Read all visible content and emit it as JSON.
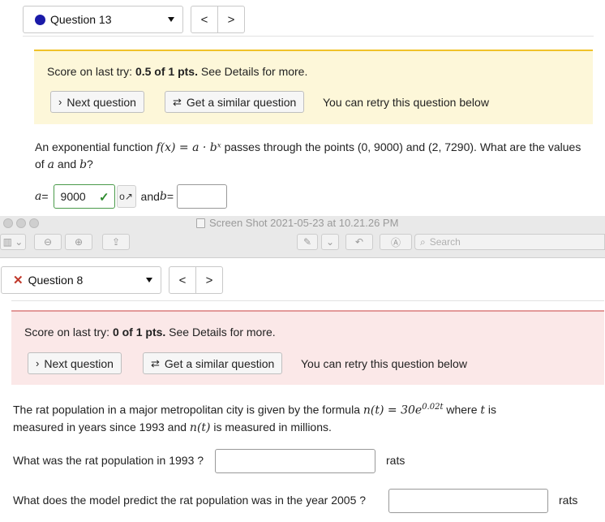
{
  "top": {
    "question_label": "Question 13",
    "nav_prev": "<",
    "nav_next": ">",
    "score_prefix": "Score on last try: ",
    "score_value": "0.5 of 1 pts.",
    "score_suffix": " See Details for more.",
    "next_question": "Next question",
    "similar_question": "Get a similar question",
    "retry_text": "You can retry this question below",
    "prompt_pre": "An exponential function ",
    "prompt_math": "f(x) = a · bˣ",
    "prompt_post": " passes through the points (0, 9000) and (2, 7290). What are the values of ",
    "prompt_a": "a",
    "prompt_and": " and ",
    "prompt_b": "b",
    "prompt_q": "?",
    "a_label_var": "a",
    "a_label_eq": " =",
    "a_value": "9000",
    "key_glyph": "o↗",
    "and_label": "and ",
    "b_label_var": "b",
    "b_label_eq": " ="
  },
  "chrome": {
    "title": "Screen Shot 2021-05-23 at 10.21.26 PM",
    "search_placeholder": "Search",
    "sidebar_glyph": "▥ ⌄",
    "zoom_out_glyph": "⊖",
    "zoom_in_glyph": "⊕",
    "share_glyph": "⇪",
    "markup_glyph": "✎",
    "dropdown_glyph": "⌄",
    "rotate_glyph": "↶",
    "annotate_glyph": "Ⓐ",
    "search_glyph": "⌕"
  },
  "bottom": {
    "question_label": "Question 8",
    "x_glyph": "✕",
    "nav_prev": "<",
    "nav_next": ">",
    "score_prefix": "Score on last try: ",
    "score_value": "0 of 1 pts.",
    "score_suffix": " See Details for more.",
    "next_question": "Next question",
    "similar_question": "Get a similar question",
    "retry_text": "You can retry this question below",
    "prompt_line1_pre": "The rat population in a major metropolitan city is given by the formula ",
    "prompt_math": "n(t) = 30e",
    "prompt_exp": "0.02t",
    "prompt_line1_post": " where ",
    "prompt_t": "t",
    "prompt_is": " is",
    "prompt_line2_pre": "measured in years since 1993 and ",
    "prompt_nt": "n(t)",
    "prompt_line2_post": " is measured in millions.",
    "q1": "What was the rat population in 1993 ?",
    "q1_unit": "rats",
    "q2": "What does the model predict the rat population was in the year 2005 ?",
    "q2_unit": "rats"
  },
  "icons": {
    "next_chevron": "›",
    "similar": "⇄",
    "check": "✓"
  },
  "colors": {
    "accent_yellow": "#f0c229",
    "accent_red": "#e39a9a",
    "correct_green": "#4a9a4a",
    "question_dot": "#1a1aa8",
    "wrong_x": "#c0392b"
  }
}
